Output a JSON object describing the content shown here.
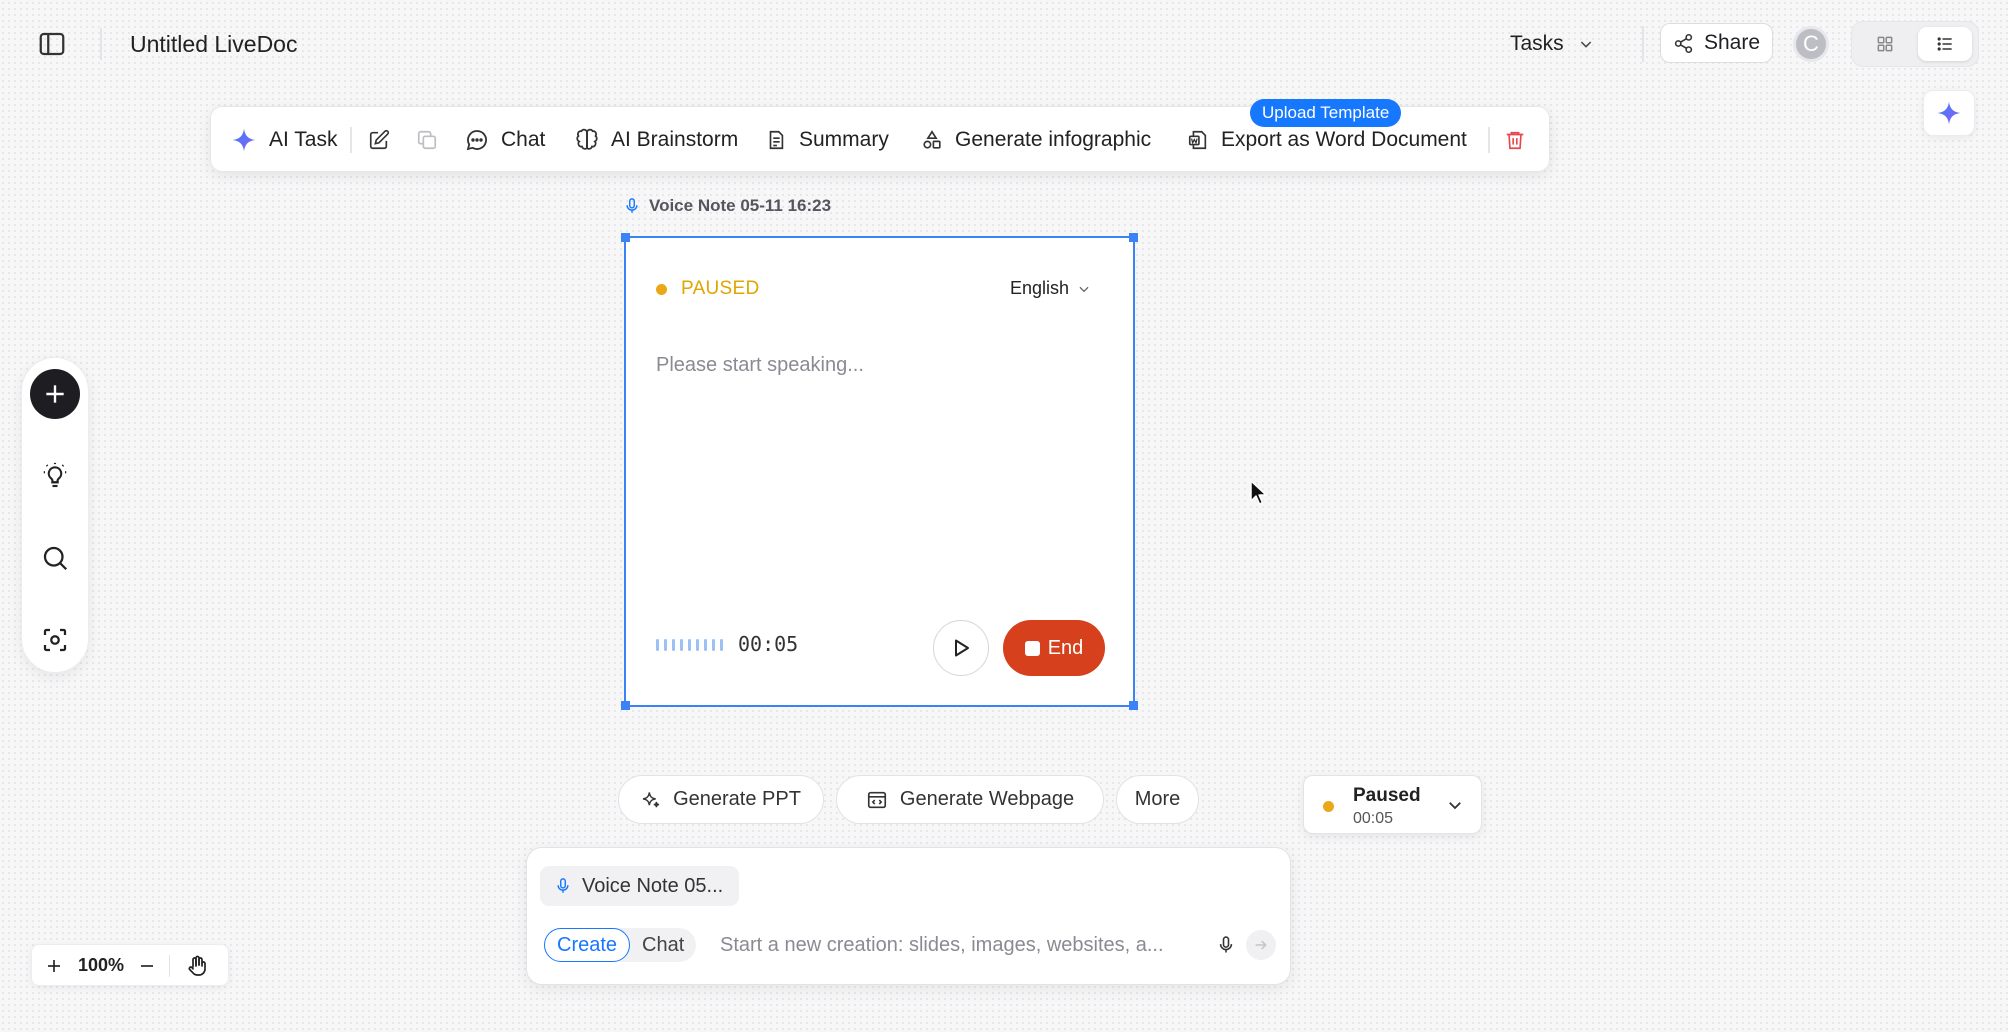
{
  "header": {
    "doc_title": "Untitled LiveDoc",
    "tasks_label": "Tasks",
    "share_label": "Share",
    "avatar_initial": "C"
  },
  "toolbar": {
    "ai_task": "AI Task",
    "chat": "Chat",
    "ai_brainstorm": "AI Brainstorm",
    "summary": "Summary",
    "generate_infographic": "Generate infographic",
    "export_word": "Export as Word Document",
    "upload_template_badge": "Upload Template"
  },
  "voice_note": {
    "caption": "Voice Note 05-11 16:23",
    "status": "PAUSED",
    "language": "English",
    "placeholder": "Please start speaking...",
    "elapsed": "00:05",
    "end_label": "End"
  },
  "quick_actions": {
    "generate_ppt": "Generate PPT",
    "generate_webpage": "Generate Webpage",
    "more": "More"
  },
  "recording_widget": {
    "status": "Paused",
    "time": "00:05"
  },
  "composer": {
    "attachment": "Voice Note 05...",
    "mode_create": "Create",
    "mode_chat": "Chat",
    "placeholder": "Start a new creation: slides, images, websites, a..."
  },
  "zoom": {
    "level": "100%"
  },
  "colors": {
    "accent_blue": "#1677ff",
    "selection_blue": "#3b82f6",
    "paused_amber": "#e9a817",
    "end_red": "#d6401d",
    "delete_red": "#e5484d"
  }
}
